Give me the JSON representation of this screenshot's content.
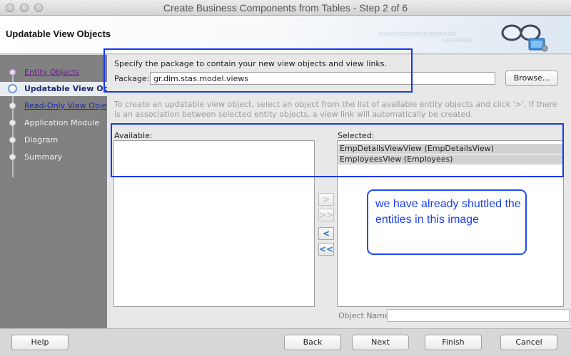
{
  "window": {
    "title": "Create Business Components from Tables - Step 2 of 6"
  },
  "header": {
    "title": "Updatable View Objects",
    "decoration_lines": [
      "01010101010100101001010101",
      "0101010101"
    ]
  },
  "nav": {
    "items": [
      {
        "label": "Entity Objects",
        "state": "visited"
      },
      {
        "label": "Updatable View Objects",
        "state": "current"
      },
      {
        "label": "Read-Only View Objects",
        "state": "link"
      },
      {
        "label": "Application Module",
        "state": "pending"
      },
      {
        "label": "Diagram",
        "state": "pending"
      },
      {
        "label": "Summary",
        "state": "pending"
      }
    ]
  },
  "package": {
    "prompt": "Specify the package to contain your new view objects and view links.",
    "label": "Package:",
    "value": "gr.dim.stas.model.views",
    "browse_label": "Browse..."
  },
  "instructions": "To create an updatable view object, select an object from the list of available entity objects and click '>'.  If there is an association between selected entity objects, a view link will automatically be created.",
  "available": {
    "label": "Available:",
    "items": []
  },
  "selected": {
    "label": "Selected:",
    "items": [
      "EmpDetailsViewView (EmpDetailsView)",
      "EmployeesView (Employees)"
    ]
  },
  "shuttle": {
    "add": ">",
    "add_all": ">>",
    "remove": "<",
    "remove_all": "<<"
  },
  "object_name": {
    "label": "Object Name:",
    "value": ""
  },
  "footer": {
    "help": "Help",
    "back": "Back",
    "next": "Next",
    "finish": "Finish",
    "cancel": "Cancel"
  },
  "annotation": {
    "text": "we have already shuttled the entities in this image"
  },
  "colors": {
    "annotation_blue": "#1438f2",
    "nav_background": "#818181",
    "current_step_accent": "#6b9bd6"
  }
}
